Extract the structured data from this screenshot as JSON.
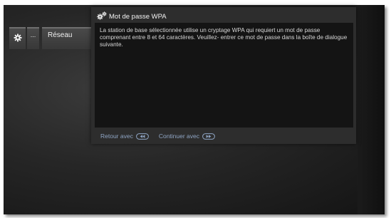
{
  "breadcrumb": {
    "gear_icon": "gear-icon",
    "ellipsis": "...",
    "label": "Réseau"
  },
  "dialog": {
    "title_icon": "gears-icon",
    "title": "Mot de passe WPA",
    "body": "La station de base sélectionnée utilise un cryptage WPA qui requiert un mot de passe comprenant entre 8 et 64 caractères. Veuillez- entrer ce mot de passe dans la boîte de dialogue suivante.",
    "footer": {
      "back_label": "Retour avec",
      "back_icon": "rewind-button-icon",
      "continue_label": "Continuer avec",
      "continue_icon": "fast-forward-button-icon"
    }
  },
  "colors": {
    "background": "#262626",
    "dialog": "#2d2d2d",
    "text_area": "#141414",
    "footer_text": "#8fa5c4"
  }
}
